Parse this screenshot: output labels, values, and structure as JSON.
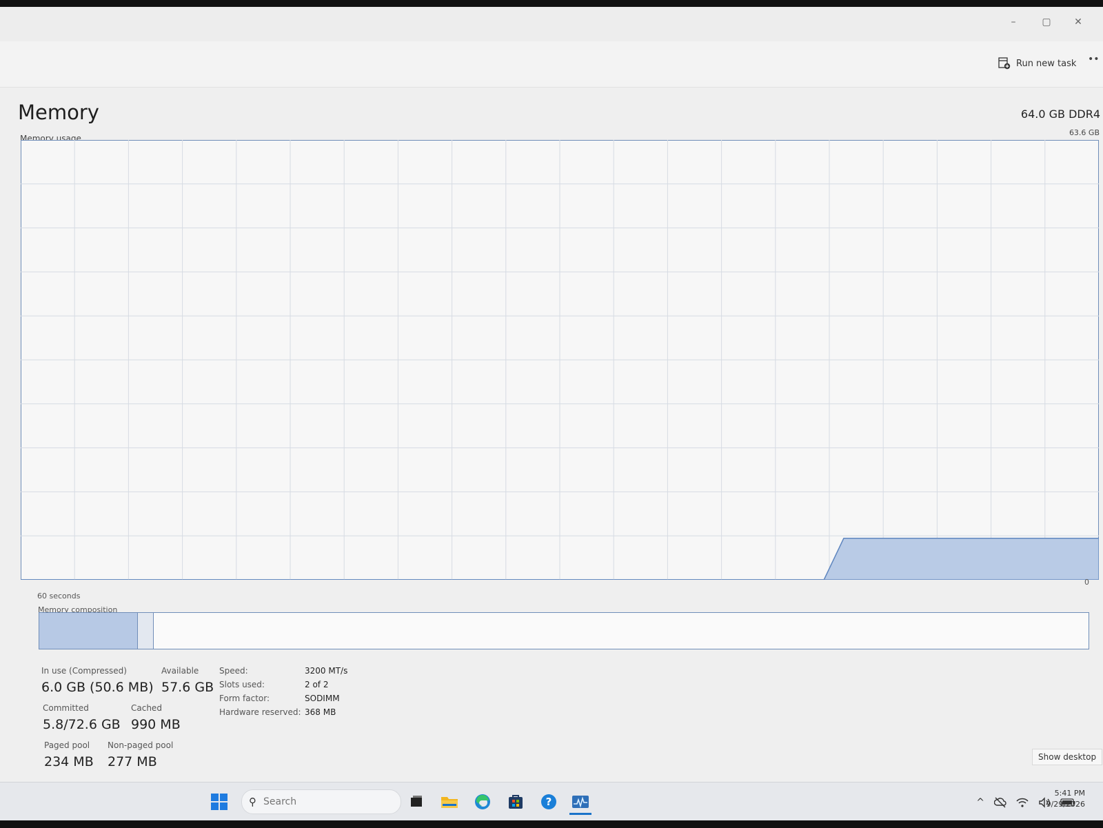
{
  "window": {
    "minimize": "–",
    "restore": "▢",
    "close": "✕"
  },
  "command_bar": {
    "run_new_task": "Run new task",
    "more": "••"
  },
  "memory": {
    "title": "Memory",
    "spec": "64.0 GB DDR4",
    "usage_label": "Memory usage",
    "max_label": "63.6 GB",
    "time_label": "60 seconds",
    "zero_label": "0",
    "composition_label": "Memory composition"
  },
  "chart_data": {
    "type": "area",
    "title": "Memory usage",
    "xlabel": "60 seconds",
    "ylabel": "",
    "xlim": [
      60,
      0
    ],
    "ylim": [
      0,
      63.6
    ],
    "grid": true,
    "x": [
      60,
      15.3,
      14.2,
      0
    ],
    "series": [
      {
        "values": [
          0,
          0,
          6.0,
          6.0
        ]
      }
    ]
  },
  "composition": {
    "in_use_fraction": 0.093,
    "modified_fraction": 0.015,
    "colors": {
      "in_use": "#b7c9e5",
      "modified": "#e3e8f0",
      "border": "#6f8db8"
    }
  },
  "stats": {
    "in_use_label": "In use (Compressed)",
    "in_use_value": "6.0 GB (50.6 MB)",
    "available_label": "Available",
    "available_value": "57.6 GB",
    "committed_label": "Committed",
    "committed_value": "5.8/72.6 GB",
    "cached_label": "Cached",
    "cached_value": "990 MB",
    "paged_label": "Paged pool",
    "paged_value": "234 MB",
    "nonpaged_label": "Non-paged pool",
    "nonpaged_value": "277 MB"
  },
  "details": {
    "speed_label": "Speed:",
    "speed_value": "3200 MT/s",
    "slots_label": "Slots used:",
    "slots_value": "2 of 2",
    "form_label": "Form factor:",
    "form_value": "SODIMM",
    "hw_label": "Hardware reserved:",
    "hw_value": "368 MB"
  },
  "show_desktop": "Show desktop",
  "taskbar": {
    "search_placeholder": "Search",
    "time": "5:41 PM",
    "date": "9/29/2026",
    "tray_chevron": "^"
  }
}
